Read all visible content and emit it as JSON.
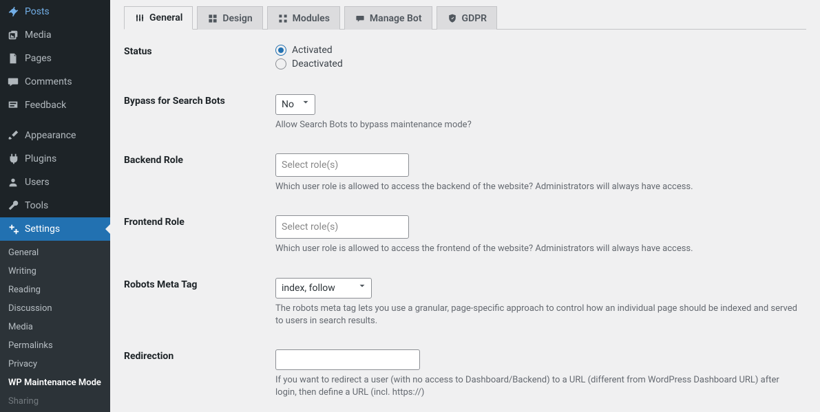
{
  "sidebar": {
    "items": [
      {
        "label": "Posts",
        "icon": "pin"
      },
      {
        "label": "Media",
        "icon": "media"
      },
      {
        "label": "Pages",
        "icon": "page"
      },
      {
        "label": "Comments",
        "icon": "comment"
      },
      {
        "label": "Feedback",
        "icon": "feedback"
      }
    ],
    "items2": [
      {
        "label": "Appearance",
        "icon": "brush"
      },
      {
        "label": "Plugins",
        "icon": "plug"
      },
      {
        "label": "Users",
        "icon": "user"
      },
      {
        "label": "Tools",
        "icon": "wrench"
      },
      {
        "label": "Settings",
        "icon": "settings"
      }
    ],
    "sub": [
      "General",
      "Writing",
      "Reading",
      "Discussion",
      "Media",
      "Permalinks",
      "Privacy",
      "WP Maintenance Mode",
      "Sharing"
    ]
  },
  "tabs": [
    {
      "label": "General",
      "icon": "sliders"
    },
    {
      "label": "Design",
      "icon": "design"
    },
    {
      "label": "Modules",
      "icon": "modules"
    },
    {
      "label": "Manage Bot",
      "icon": "bot"
    },
    {
      "label": "GDPR",
      "icon": "shield"
    }
  ],
  "form": {
    "status": {
      "label": "Status",
      "activated": "Activated",
      "deactivated": "Deactivated",
      "value": "Activated"
    },
    "bypass": {
      "label": "Bypass for Search Bots",
      "value": "No",
      "desc": "Allow Search Bots to bypass maintenance mode?"
    },
    "backend": {
      "label": "Backend Role",
      "placeholder": "Select role(s)",
      "desc": "Which user role is allowed to access the backend of the website? Administrators will always have access."
    },
    "frontend": {
      "label": "Frontend Role",
      "placeholder": "Select role(s)",
      "desc": "Which user role is allowed to access the frontend of the website? Administrators will always have access."
    },
    "robots": {
      "label": "Robots Meta Tag",
      "value": "index, follow",
      "desc": "The robots meta tag lets you use a granular, page-specific approach to control how an individual page should be indexed and served to users in search results."
    },
    "redirect": {
      "label": "Redirection",
      "value": "",
      "desc": "If you want to redirect a user (with no access to Dashboard/Backend) to a URL (different from WordPress Dashboard URL) after login, then define a URL (incl. https://)"
    }
  }
}
